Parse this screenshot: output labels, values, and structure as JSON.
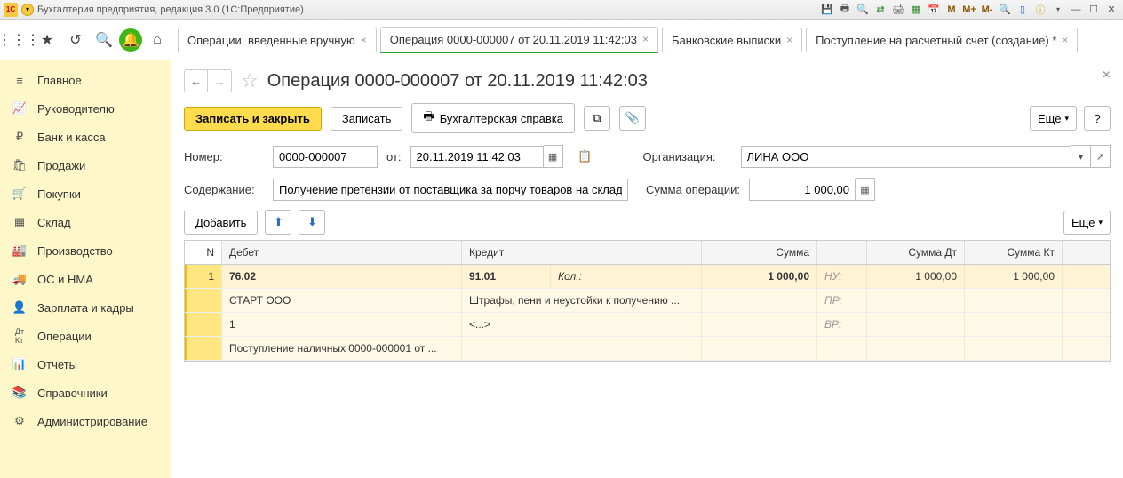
{
  "app": {
    "title": "Бухгалтерия предприятия, редакция 3.0  (1С:Предприятие)"
  },
  "toolbar_m": {
    "m": "M",
    "mplus": "M+",
    "mminus": "M-"
  },
  "tabs": [
    {
      "label": "Операции, введенные вручную"
    },
    {
      "label": "Операция 0000-000007 от 20.11.2019 11:42:03"
    },
    {
      "label": "Банковские выписки"
    },
    {
      "label": "Поступление на расчетный счет (создание) *"
    }
  ],
  "sidebar": {
    "items": [
      {
        "label": "Главное"
      },
      {
        "label": "Руководителю"
      },
      {
        "label": "Банк и касса"
      },
      {
        "label": "Продажи"
      },
      {
        "label": "Покупки"
      },
      {
        "label": "Склад"
      },
      {
        "label": "Производство"
      },
      {
        "label": "ОС и НМА"
      },
      {
        "label": "Зарплата и кадры"
      },
      {
        "label": "Операции"
      },
      {
        "label": "Отчеты"
      },
      {
        "label": "Справочники"
      },
      {
        "label": "Администрирование"
      }
    ]
  },
  "doc": {
    "title": "Операция 0000-000007 от 20.11.2019 11:42:03",
    "save_close": "Записать и закрыть",
    "save": "Записать",
    "report": "Бухгалтерская справка",
    "more": "Еще",
    "help": "?",
    "number_label": "Номер:",
    "number": "0000-000007",
    "from_label": "от:",
    "date": "20.11.2019 11:42:03",
    "org_label": "Организация:",
    "org": "ЛИНА ООО",
    "content_label": "Содержание:",
    "content": "Получение претензии от поставщика за порчу товаров на складе",
    "sumop_label": "Сумма операции:",
    "sumop": "1 000,00",
    "add": "Добавить"
  },
  "grid": {
    "headers": {
      "n": "N",
      "debit": "Дебет",
      "credit": "Кредит",
      "sum": "Сумма",
      "sumdt": "Сумма Дт",
      "sumkt": "Сумма Кт"
    },
    "row1": {
      "n": "1",
      "debit_acc": "76.02",
      "credit_acc": "91.01",
      "credit_qty": "Кол.:",
      "sum": "1 000,00",
      "nu": "НУ:",
      "sumdt": "1 000,00",
      "sumkt": "1 000,00"
    },
    "row2": {
      "debit": "СТАРТ ООО",
      "credit": "Штрафы, пени и неустойки к получению ...",
      "pr": "ПР:"
    },
    "row3": {
      "debit": "1",
      "credit": "<...>",
      "vr": "ВР:"
    },
    "row4": {
      "debit": "Поступление наличных 0000-000001 от ..."
    }
  }
}
